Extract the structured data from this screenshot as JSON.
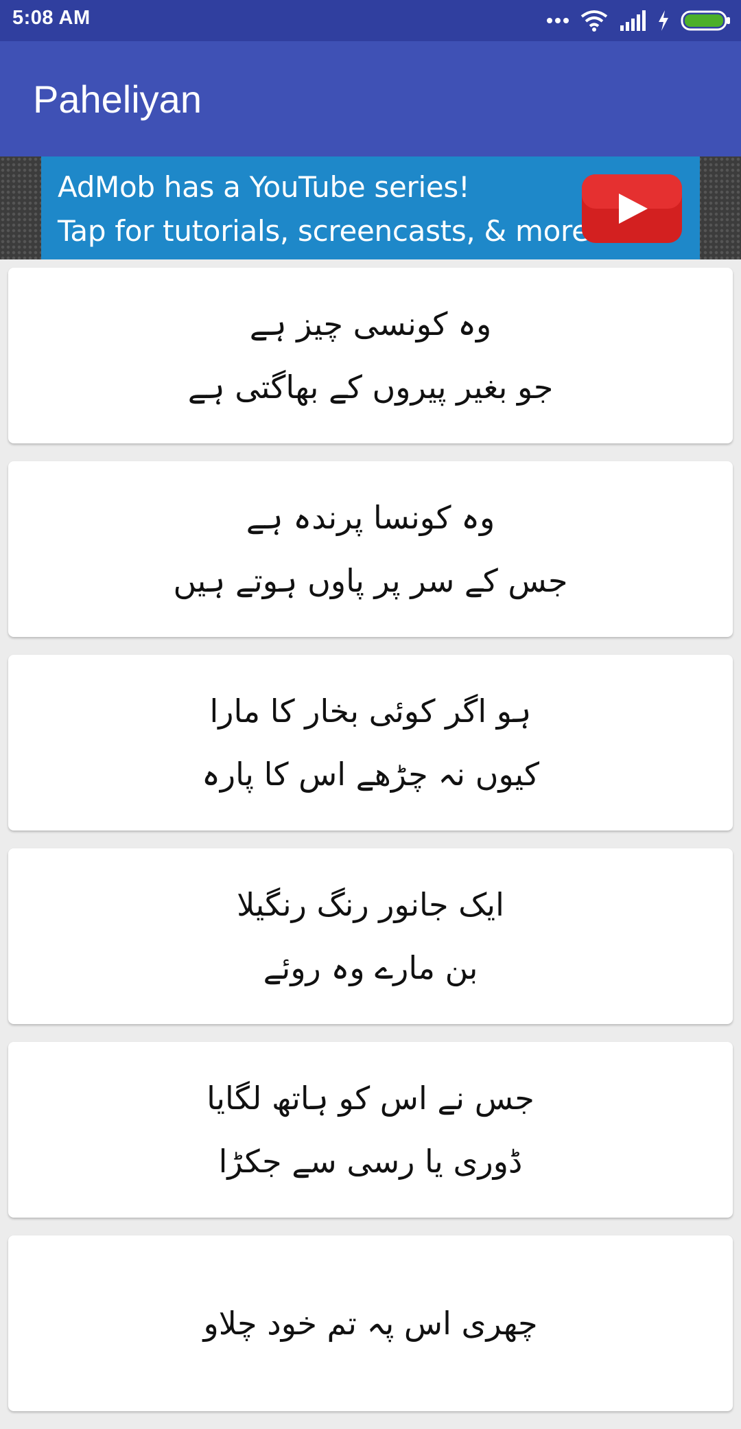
{
  "status_bar": {
    "time": "5:08 AM",
    "icons": [
      "more-dots-icon",
      "wifi-icon",
      "signal-icon",
      "charging-icon",
      "battery-icon"
    ],
    "color": "#303f9f"
  },
  "app_bar": {
    "title": "Paheliyan",
    "color": "#3f51b5"
  },
  "ad": {
    "line1": "AdMob has a YouTube series!",
    "line2": "Tap for tutorials, screencasts, & more.",
    "icon": "youtube-play-icon",
    "color": "#1e88c9"
  },
  "riddles": [
    {
      "line1": "وہ کونسی چیز ہے",
      "line2": "جو بغیر پیروں کے بھاگتی ہے"
    },
    {
      "line1": "وہ کونسا پرندہ ہے",
      "line2": "جس کے سر پر پاوں ہوتے ہیں"
    },
    {
      "line1": "ہو اگر کوئی بخار کا مارا",
      "line2": "کیوں نہ چڑھے اس کا پارہ"
    },
    {
      "line1": "ایک جانور رنگ رنگیلا",
      "line2": "بن مارے وہ روئے"
    },
    {
      "line1": "جس نے اس کو ہاتھ لگایا",
      "line2": "ڈوری یا رسی سے جکڑا"
    },
    {
      "line1": "چھری اس پہ تم خود چلاو",
      "line2": ""
    }
  ]
}
